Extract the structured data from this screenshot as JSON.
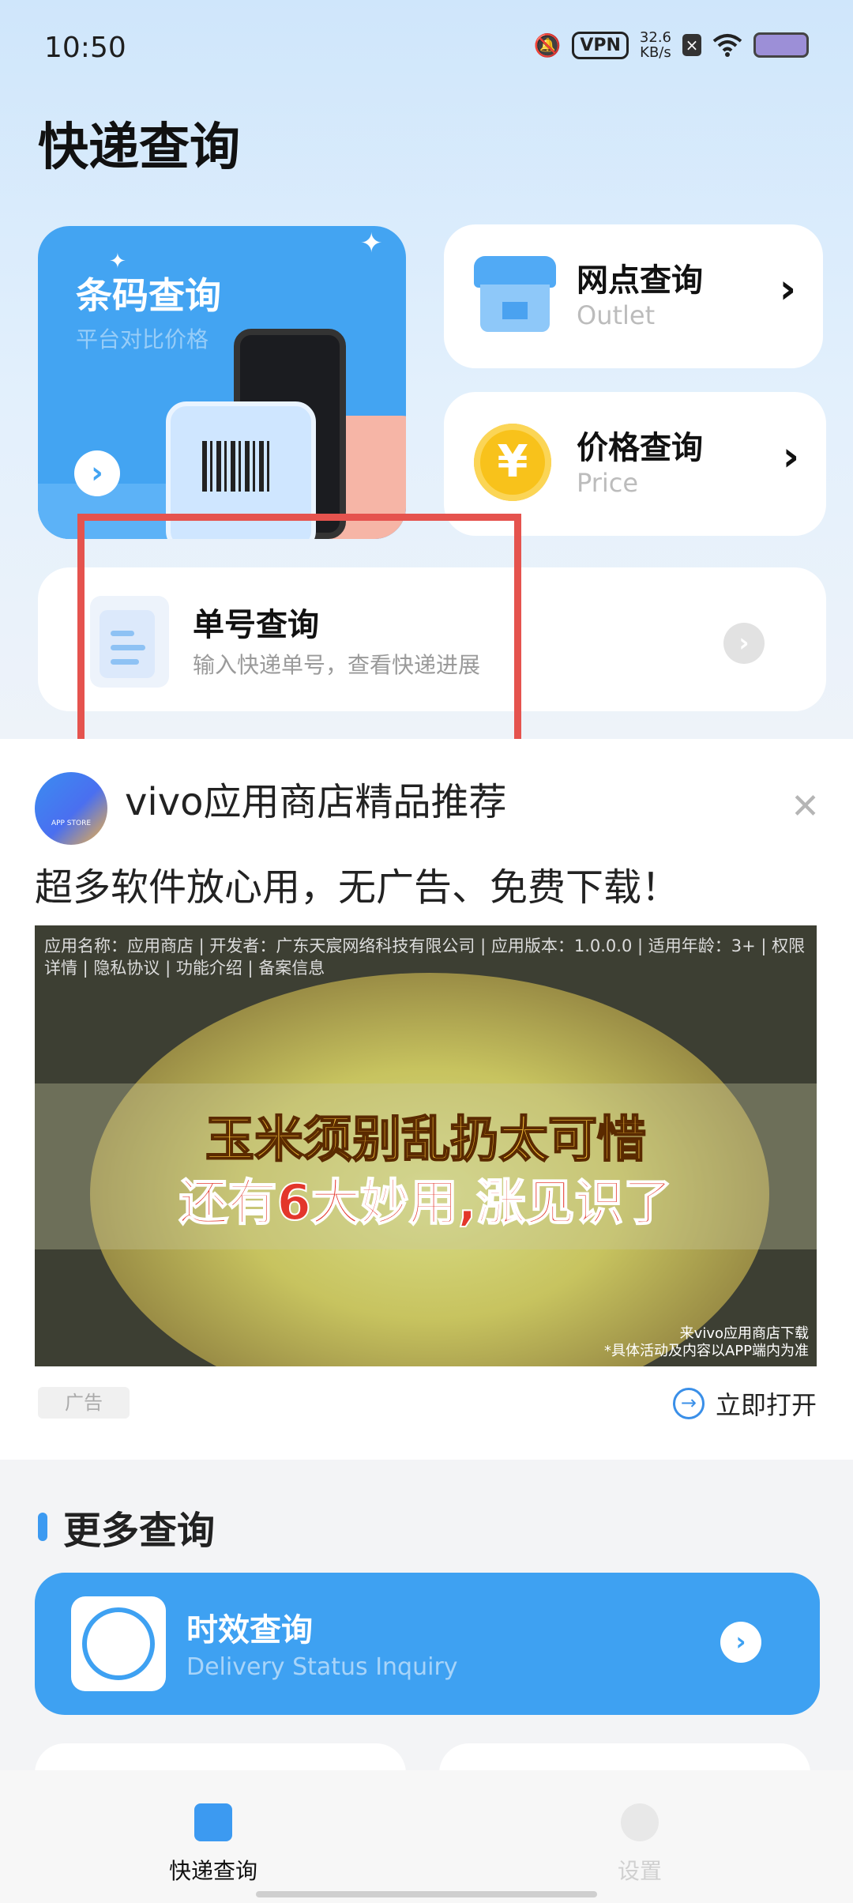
{
  "status_bar": {
    "time": "10:50",
    "vpn": "VPN",
    "speed_value": "32.6",
    "speed_unit": "KB/s"
  },
  "page_title": "快递查询",
  "barcode_card": {
    "title": "条码查询",
    "subtitle": "平台对比价格"
  },
  "outlet_card": {
    "title": "网点查询",
    "subtitle": "Outlet"
  },
  "price_card": {
    "title": "价格查询",
    "subtitle": "Price",
    "symbol": "¥"
  },
  "tracking_card": {
    "title": "单号查询",
    "subtitle": "输入快递单号，查看快递进展"
  },
  "ad": {
    "logo_text": "APP STORE",
    "title": "vivo应用商店精品推荐",
    "subtitle": "超多软件放心用，无广告、免费下载！",
    "info_line": "应用名称：应用商店 | 开发者：广东天宸网络科技有限公司 | 应用版本：1.0.0.0 | 适用年龄：3+ | 权限详情 | 隐私协议 | 功能介绍 | 备案信息",
    "headline_1": "玉米须别乱扔太可惜",
    "headline_2": "还有6大妙用,涨见识了",
    "footer_1": "来vivo应用商店下载",
    "footer_2": "*具体活动及内容以APP端内为准",
    "ad_tag": "广告",
    "open_label": "立即打开"
  },
  "more_section": {
    "title": "更多查询",
    "items": [
      {
        "title": "时效查询",
        "subtitle": "Delivery Status Inquiry"
      }
    ]
  },
  "tabbar": {
    "tabs": [
      {
        "label": "快递查询",
        "active": true
      },
      {
        "label": "设置",
        "active": false
      }
    ]
  },
  "colors": {
    "accent": "#3ea1f2",
    "highlight": "#e5534e"
  }
}
